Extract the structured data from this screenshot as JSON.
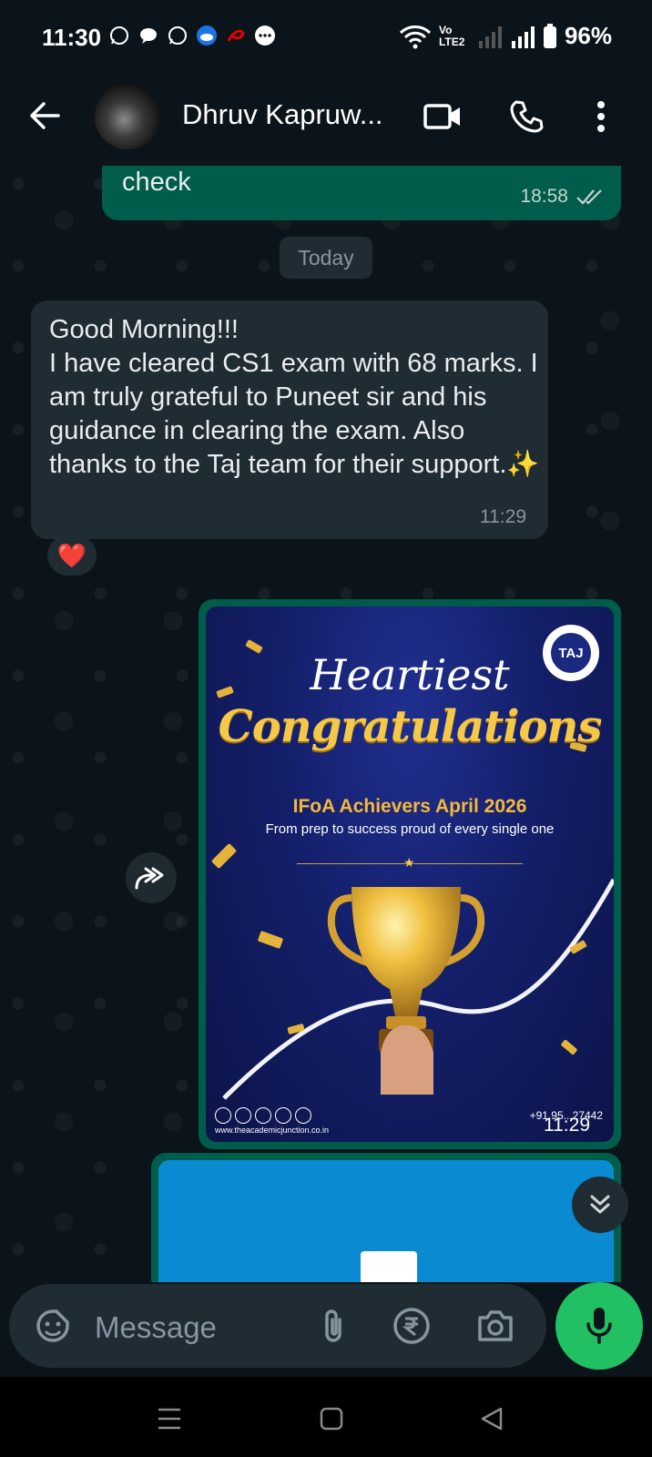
{
  "status_bar": {
    "time": "11:30",
    "network": "Vo LTE2",
    "battery": "96%",
    "icons": [
      "whatsapp-icon",
      "chat-icon",
      "whatsapp-icon",
      "weather-icon",
      "airtel-icon",
      "more-dots-icon"
    ]
  },
  "header": {
    "contact_name": "Dhruv Kapruw...",
    "icons": [
      "back-arrow-icon",
      "video-call-icon",
      "voice-call-icon",
      "more-vert-icon"
    ]
  },
  "messages": {
    "prev_outgoing": {
      "text": "check",
      "time": "18:58",
      "ticks": "double-check"
    },
    "date_chip": "Today",
    "incoming": {
      "text": "Good Morning!!!\nI have cleared CS1 exam with 68 marks. I am truly grateful to Puneet sir and his guidance in clearing the exam. Also thanks to the Taj team for their support.✨",
      "time": "11:29",
      "reaction": "❤️"
    },
    "image_message": {
      "heading_script": "Heartiest",
      "heading_main": "Congratulations",
      "achievers_title": "IFoA Achievers April 2026",
      "achievers_sub": "From prep to success proud of every single one",
      "logo_text": "TAJ",
      "website": "www.theacademicjunction.co.in",
      "phone": "+91 95...27442",
      "time": "11:29"
    }
  },
  "input": {
    "placeholder": "Message",
    "icons": [
      "sticker-icon",
      "attach-icon",
      "rupee-icon",
      "camera-icon",
      "mic-icon"
    ]
  },
  "colors": {
    "background": "#0b141a",
    "incoming_bubble": "#202c33",
    "outgoing_bubble": "#005c4b",
    "accent_green": "#21c063",
    "poster_blue": "#141f6a",
    "gold": "#f5c84a"
  }
}
